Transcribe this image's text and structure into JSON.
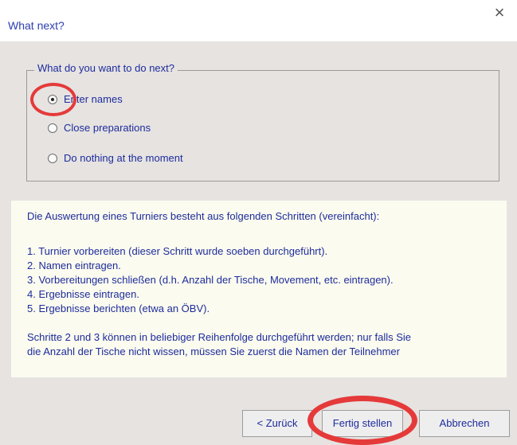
{
  "window": {
    "title": "What next?",
    "close_glyph": "×"
  },
  "group": {
    "legend": "What do you want to do next?",
    "options": [
      {
        "label": "Enter names",
        "selected": true
      },
      {
        "label": "Close preparations",
        "selected": false
      },
      {
        "label": "Do nothing at the moment",
        "selected": false
      }
    ]
  },
  "info": {
    "intro": "Die Auswertung eines Turniers besteht aus folgenden Schritten (vereinfacht):",
    "steps": [
      "1. Turnier vorbereiten (dieser Schritt wurde soeben durchgeführt).",
      "2. Namen eintragen.",
      "3. Vorbereitungen schließen (d.h. Anzahl der Tische, Movement, etc. eintragen).",
      "4. Ergebnisse eintragen.",
      "5. Ergebnisse berichten (etwa an ÖBV)."
    ],
    "note_line1": "Schritte 2 und 3 können in beliebiger Reihenfolge durchgeführt werden; nur falls Sie",
    "note_line2": "die Anzahl der Tische nicht wissen, müssen Sie zuerst die Namen der Teilnehmer"
  },
  "buttons": {
    "back": "< Zurück",
    "finish": "Fertig stellen",
    "cancel": "Abbrechen"
  },
  "colors": {
    "text": "#1e2c9c",
    "highlight": "#e53a3a",
    "info_background": "#fbfbef"
  }
}
